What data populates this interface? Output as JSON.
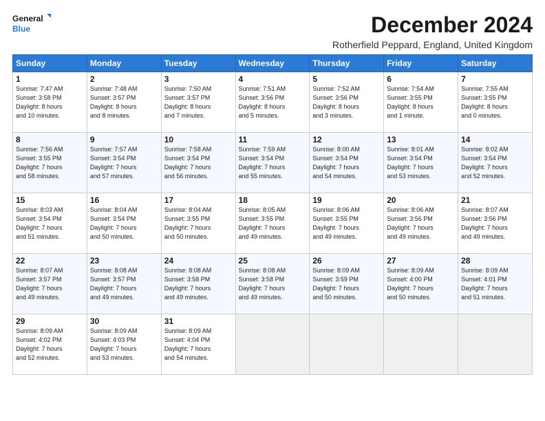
{
  "header": {
    "logo_line1": "General",
    "logo_line2": "Blue",
    "title": "December 2024",
    "subtitle": "Rotherfield Peppard, England, United Kingdom"
  },
  "columns": [
    "Sunday",
    "Monday",
    "Tuesday",
    "Wednesday",
    "Thursday",
    "Friday",
    "Saturday"
  ],
  "weeks": [
    [
      {
        "day": "1",
        "info": "Sunrise: 7:47 AM\nSunset: 3:58 PM\nDaylight: 8 hours\nand 10 minutes."
      },
      {
        "day": "2",
        "info": "Sunrise: 7:48 AM\nSunset: 3:57 PM\nDaylight: 8 hours\nand 8 minutes."
      },
      {
        "day": "3",
        "info": "Sunrise: 7:50 AM\nSunset: 3:57 PM\nDaylight: 8 hours\nand 7 minutes."
      },
      {
        "day": "4",
        "info": "Sunrise: 7:51 AM\nSunset: 3:56 PM\nDaylight: 8 hours\nand 5 minutes."
      },
      {
        "day": "5",
        "info": "Sunrise: 7:52 AM\nSunset: 3:56 PM\nDaylight: 8 hours\nand 3 minutes."
      },
      {
        "day": "6",
        "info": "Sunrise: 7:54 AM\nSunset: 3:55 PM\nDaylight: 8 hours\nand 1 minute."
      },
      {
        "day": "7",
        "info": "Sunrise: 7:55 AM\nSunset: 3:55 PM\nDaylight: 8 hours\nand 0 minutes."
      }
    ],
    [
      {
        "day": "8",
        "info": "Sunrise: 7:56 AM\nSunset: 3:55 PM\nDaylight: 7 hours\nand 58 minutes."
      },
      {
        "day": "9",
        "info": "Sunrise: 7:57 AM\nSunset: 3:54 PM\nDaylight: 7 hours\nand 57 minutes."
      },
      {
        "day": "10",
        "info": "Sunrise: 7:58 AM\nSunset: 3:54 PM\nDaylight: 7 hours\nand 56 minutes."
      },
      {
        "day": "11",
        "info": "Sunrise: 7:59 AM\nSunset: 3:54 PM\nDaylight: 7 hours\nand 55 minutes."
      },
      {
        "day": "12",
        "info": "Sunrise: 8:00 AM\nSunset: 3:54 PM\nDaylight: 7 hours\nand 54 minutes."
      },
      {
        "day": "13",
        "info": "Sunrise: 8:01 AM\nSunset: 3:54 PM\nDaylight: 7 hours\nand 53 minutes."
      },
      {
        "day": "14",
        "info": "Sunrise: 8:02 AM\nSunset: 3:54 PM\nDaylight: 7 hours\nand 52 minutes."
      }
    ],
    [
      {
        "day": "15",
        "info": "Sunrise: 8:03 AM\nSunset: 3:54 PM\nDaylight: 7 hours\nand 51 minutes."
      },
      {
        "day": "16",
        "info": "Sunrise: 8:04 AM\nSunset: 3:54 PM\nDaylight: 7 hours\nand 50 minutes."
      },
      {
        "day": "17",
        "info": "Sunrise: 8:04 AM\nSunset: 3:55 PM\nDaylight: 7 hours\nand 50 minutes."
      },
      {
        "day": "18",
        "info": "Sunrise: 8:05 AM\nSunset: 3:55 PM\nDaylight: 7 hours\nand 49 minutes."
      },
      {
        "day": "19",
        "info": "Sunrise: 8:06 AM\nSunset: 3:55 PM\nDaylight: 7 hours\nand 49 minutes."
      },
      {
        "day": "20",
        "info": "Sunrise: 8:06 AM\nSunset: 3:56 PM\nDaylight: 7 hours\nand 49 minutes."
      },
      {
        "day": "21",
        "info": "Sunrise: 8:07 AM\nSunset: 3:56 PM\nDaylight: 7 hours\nand 49 minutes."
      }
    ],
    [
      {
        "day": "22",
        "info": "Sunrise: 8:07 AM\nSunset: 3:57 PM\nDaylight: 7 hours\nand 49 minutes."
      },
      {
        "day": "23",
        "info": "Sunrise: 8:08 AM\nSunset: 3:57 PM\nDaylight: 7 hours\nand 49 minutes."
      },
      {
        "day": "24",
        "info": "Sunrise: 8:08 AM\nSunset: 3:58 PM\nDaylight: 7 hours\nand 49 minutes."
      },
      {
        "day": "25",
        "info": "Sunrise: 8:08 AM\nSunset: 3:58 PM\nDaylight: 7 hours\nand 49 minutes."
      },
      {
        "day": "26",
        "info": "Sunrise: 8:09 AM\nSunset: 3:59 PM\nDaylight: 7 hours\nand 50 minutes."
      },
      {
        "day": "27",
        "info": "Sunrise: 8:09 AM\nSunset: 4:00 PM\nDaylight: 7 hours\nand 50 minutes."
      },
      {
        "day": "28",
        "info": "Sunrise: 8:09 AM\nSunset: 4:01 PM\nDaylight: 7 hours\nand 51 minutes."
      }
    ],
    [
      {
        "day": "29",
        "info": "Sunrise: 8:09 AM\nSunset: 4:02 PM\nDaylight: 7 hours\nand 52 minutes."
      },
      {
        "day": "30",
        "info": "Sunrise: 8:09 AM\nSunset: 4:03 PM\nDaylight: 7 hours\nand 53 minutes."
      },
      {
        "day": "31",
        "info": "Sunrise: 8:09 AM\nSunset: 4:04 PM\nDaylight: 7 hours\nand 54 minutes."
      },
      null,
      null,
      null,
      null
    ]
  ]
}
